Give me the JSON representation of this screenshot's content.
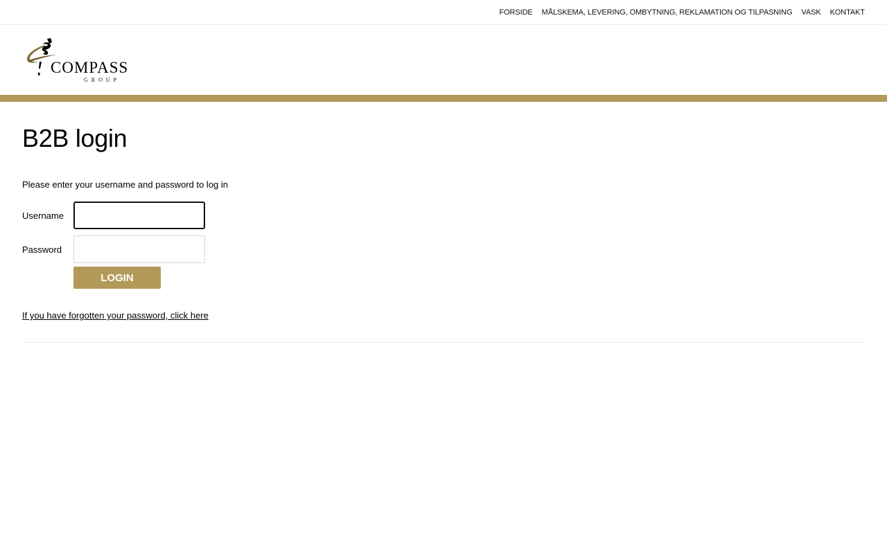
{
  "nav": {
    "items": [
      {
        "label": "FORSIDE"
      },
      {
        "label": "MÅLSKEMA, LEVERING, OMBYTNING, REKLAMATION OG TILPASNING"
      },
      {
        "label": "VASK"
      },
      {
        "label": "KONTAKT"
      }
    ]
  },
  "brand": {
    "logo_text": "COMPASS",
    "logo_subtext": "GROUP",
    "accent_color": "#b39a5a"
  },
  "page": {
    "title": "B2B login",
    "intro": "Please enter your username and password to log in"
  },
  "form": {
    "username_label": "Username",
    "username_value": "",
    "password_label": "Password",
    "password_value": "",
    "login_label": "LOGIN",
    "forgot_link": "If you have forgotten your password, click here"
  }
}
